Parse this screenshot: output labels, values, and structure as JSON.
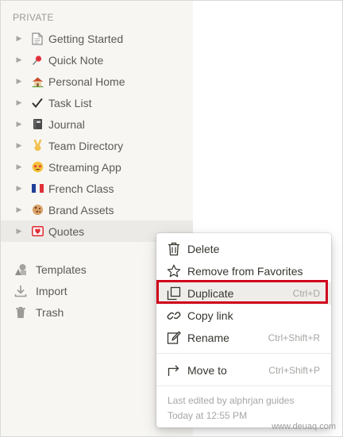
{
  "sidebar": {
    "section_label": "PRIVATE",
    "pages": [
      {
        "label": "Getting Started",
        "icon": "document-icon"
      },
      {
        "label": "Quick Note",
        "icon": "pushpin-icon"
      },
      {
        "label": "Personal Home",
        "icon": "house-icon"
      },
      {
        "label": "Task List",
        "icon": "checkmark-icon"
      },
      {
        "label": "Journal",
        "icon": "notebook-icon"
      },
      {
        "label": "Team Directory",
        "icon": "victory-hand-icon"
      },
      {
        "label": "Streaming App",
        "icon": "star-eyes-face-icon"
      },
      {
        "label": "French Class",
        "icon": "french-flag-icon"
      },
      {
        "label": "Brand Assets",
        "icon": "cookie-icon"
      },
      {
        "label": "Quotes",
        "icon": "heart-letter-icon"
      }
    ],
    "utilities": [
      {
        "label": "Templates",
        "icon": "shapes-icon"
      },
      {
        "label": "Import",
        "icon": "download-icon"
      },
      {
        "label": "Trash",
        "icon": "trash-icon"
      }
    ]
  },
  "context_menu": {
    "items": [
      {
        "label": "Delete",
        "shortcut": "",
        "icon": "trash-icon"
      },
      {
        "label": "Remove from Favorites",
        "shortcut": "",
        "icon": "star-outline-icon"
      },
      {
        "label": "Duplicate",
        "shortcut": "Ctrl+D",
        "icon": "duplicate-icon"
      },
      {
        "label": "Copy link",
        "shortcut": "",
        "icon": "link-icon"
      },
      {
        "label": "Rename",
        "shortcut": "Ctrl+Shift+R",
        "icon": "pencil-icon"
      },
      {
        "label": "Move to",
        "shortcut": "Ctrl+Shift+P",
        "icon": "move-arrow-icon"
      }
    ],
    "footer": {
      "line1": "Last edited by alphrjan guides",
      "line2": "Today at 12:55 PM"
    }
  },
  "watermark": "www.deuaq.com",
  "colors": {
    "sidebar_bg": "#f7f6f3",
    "highlight_border": "#d0021b"
  }
}
